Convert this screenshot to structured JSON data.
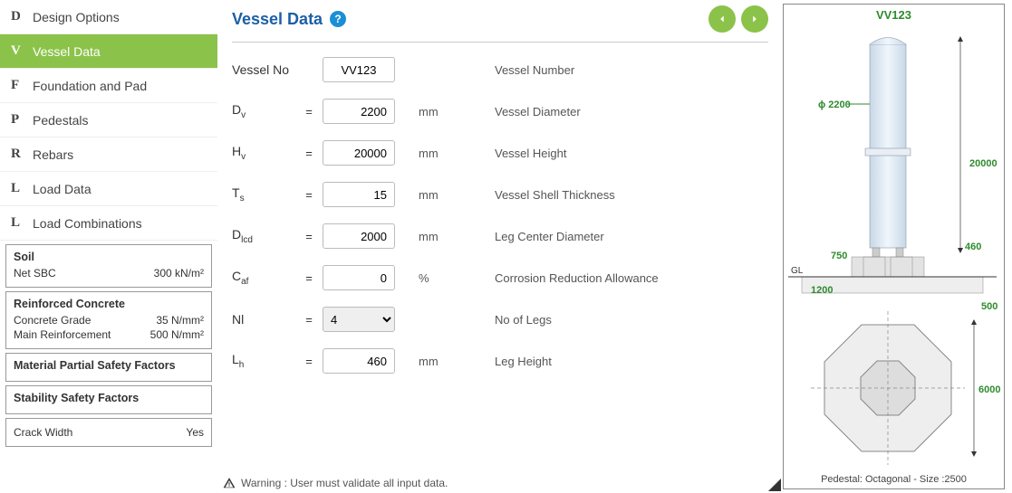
{
  "sidebar": {
    "items": [
      {
        "letter": "D",
        "label": "Design Options"
      },
      {
        "letter": "V",
        "label": "Vessel Data"
      },
      {
        "letter": "F",
        "label": "Foundation and Pad"
      },
      {
        "letter": "P",
        "label": "Pedestals"
      },
      {
        "letter": "R",
        "label": "Rebars"
      },
      {
        "letter": "L",
        "label": "Load Data"
      },
      {
        "letter": "L",
        "label": "Load Combinations"
      }
    ],
    "soil": {
      "header": "Soil",
      "row_label": "Net SBC",
      "row_value": "300 kN/m²"
    },
    "concrete": {
      "header": "Reinforced Concrete",
      "r1_label": "Concrete Grade",
      "r1_value": "35 N/mm²",
      "r2_label": "Main Reinforcement",
      "r2_value": "500 N/mm²"
    },
    "mpsf": {
      "header": "Material Partial Safety Factors"
    },
    "ssf": {
      "header": "Stability Safety Factors"
    },
    "crack": {
      "label": "Crack Width",
      "value": "Yes"
    }
  },
  "header": {
    "title": "Vessel Data"
  },
  "form": {
    "vessel_no": {
      "symbol": "Vessel No",
      "value": "VV123",
      "desc": "Vessel Number",
      "unit": ""
    },
    "dv": {
      "value": "2200",
      "unit": "mm",
      "desc": "Vessel Diameter"
    },
    "hv": {
      "value": "20000",
      "unit": "mm",
      "desc": "Vessel Height"
    },
    "ts": {
      "value": "15",
      "unit": "mm",
      "desc": "Vessel Shell Thickness"
    },
    "dlcd": {
      "value": "2000",
      "unit": "mm",
      "desc": "Leg Center Diameter"
    },
    "caf": {
      "value": "0",
      "unit": "%",
      "desc": "Corrosion Reduction Allowance"
    },
    "nl": {
      "value": "4",
      "desc": "No of Legs"
    },
    "lh": {
      "value": "460",
      "unit": "mm",
      "desc": "Leg Height"
    }
  },
  "diagram": {
    "title": "VV123",
    "dia": "ɸ 2200",
    "height": "20000",
    "leg": "460",
    "ped_h": "750",
    "pad_h": "1200",
    "below": "500",
    "plan": "6000",
    "caption": "Pedestal: Octagonal - Size :2500",
    "gl": "GL"
  },
  "warning": "Warning : User must validate all input data."
}
